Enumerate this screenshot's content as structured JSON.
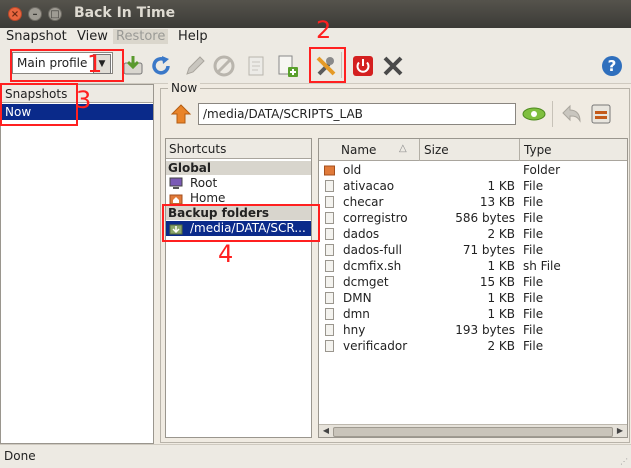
{
  "window": {
    "title": "Back In Time"
  },
  "menubar": {
    "items": [
      "Snapshot",
      "View",
      "Restore",
      "Help"
    ]
  },
  "toolbar": {
    "profile_value": "Main profile"
  },
  "annotations": [
    "1",
    "2",
    "3",
    "4"
  ],
  "snapshots": {
    "header": "Snapshots",
    "items": [
      "Now"
    ]
  },
  "now": {
    "label": "Now",
    "path": "/media/DATA/SCRIPTS_LAB"
  },
  "shortcuts": {
    "header": "Shortcuts",
    "global_label": "Global",
    "global_items": [
      "Root",
      "Home"
    ],
    "backup_label": "Backup folders",
    "backup_items": [
      "/media/DATA/SCR..."
    ]
  },
  "files": {
    "columns": [
      "Name",
      "Size",
      "Type"
    ],
    "rows": [
      {
        "name": "old",
        "size": "",
        "type": "Folder"
      },
      {
        "name": "ativacao",
        "size": "1 KB",
        "type": "File"
      },
      {
        "name": "checar",
        "size": "13 KB",
        "type": "File"
      },
      {
        "name": "corregistro",
        "size": "586 bytes",
        "type": "File"
      },
      {
        "name": "dados",
        "size": "2 KB",
        "type": "File"
      },
      {
        "name": "dados-full",
        "size": "71 bytes",
        "type": "File"
      },
      {
        "name": "dcmfix.sh",
        "size": "1 KB",
        "type": "sh File"
      },
      {
        "name": "dcmget",
        "size": "15 KB",
        "type": "File"
      },
      {
        "name": "DMN",
        "size": "1 KB",
        "type": "File"
      },
      {
        "name": "dmn",
        "size": "1 KB",
        "type": "File"
      },
      {
        "name": "hny",
        "size": "193 bytes",
        "type": "File"
      },
      {
        "name": "verificador",
        "size": "2 KB",
        "type": "File"
      }
    ]
  },
  "status": {
    "text": "Done"
  },
  "colors": {
    "selection": "#0a2a8a",
    "annotation": "#ff2020",
    "folder": "#e07a3a"
  }
}
